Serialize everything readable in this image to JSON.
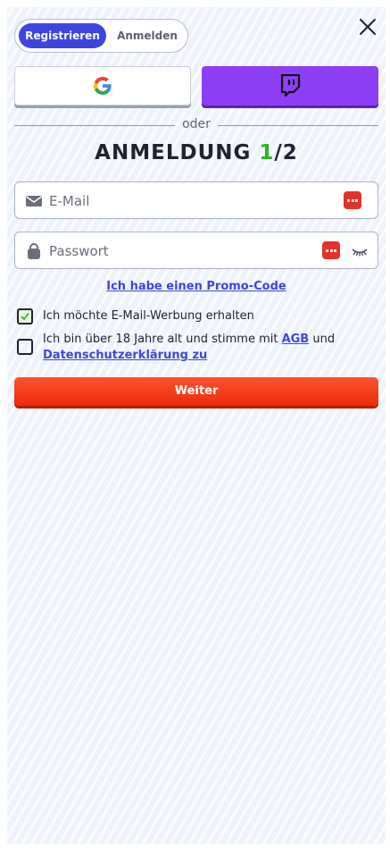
{
  "tabs": {
    "register_label": "Registrieren",
    "login_label": "Anmelden",
    "active": "register"
  },
  "social": {
    "google_icon": "google-logo-icon",
    "twitch_icon": "twitch-logo-icon",
    "twitch_color": "#8c3ff5"
  },
  "divider": {
    "text": "oder"
  },
  "heading": {
    "title": "ANMELDUNG",
    "step_current": "1",
    "step_total": "/2"
  },
  "email_field": {
    "placeholder": "E-Mail",
    "value": "",
    "icon": "envelope-icon"
  },
  "password_field": {
    "placeholder": "Passwort",
    "value": "",
    "icon": "lock-icon",
    "visibility_icon": "eye-closed-icon"
  },
  "promo": {
    "link_text": "Ich habe einen Promo-Code"
  },
  "checkboxes": {
    "email_ads": {
      "label": "Ich möchte E-Mail-Werbung erhalten",
      "checked": true
    },
    "terms": {
      "label_before": "Ich bin über 18 Jahre alt und stimme mit ",
      "agb_link": "AGB",
      "label_middle": " und ",
      "privacy_link": "Datenschutzerklärung zu",
      "checked": false
    }
  },
  "submit": {
    "label": "Weiter"
  },
  "colors": {
    "primary": "#3d45e0",
    "accent_green": "#2bb51e",
    "cta": "#ed2a08"
  }
}
